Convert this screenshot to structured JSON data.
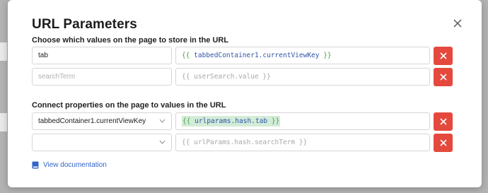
{
  "modal": {
    "title": "URL Parameters",
    "close_icon": "close-icon"
  },
  "store_section": {
    "label": "Choose which values on the page to store in the URL",
    "rows": [
      {
        "key": "tab",
        "key_placeholder": "",
        "value": "{{ tabbedContainer1.currentViewKey }}"
      },
      {
        "key": "",
        "key_placeholder": "searchTerm",
        "value_placeholder": "{{ userSearch.value }}"
      }
    ]
  },
  "connect_section": {
    "label": "Connect properties on the page to values in the URL",
    "rows": [
      {
        "property": "tabbedContainer1.currentViewKey",
        "value": "{{ urlparams.hash.tab }}"
      },
      {
        "property": "",
        "value_placeholder": "{{ urlParams.hash.searchTerm }}"
      }
    ]
  },
  "footer": {
    "doc_link_label": "View documentation",
    "doc_link_icon": "book-icon"
  },
  "colors": {
    "accent_red": "#e5493e",
    "link_blue": "#3264c8",
    "code_green": "#4aa146",
    "code_blue": "#2d55a8",
    "highlight_green": "#d3ecd8"
  }
}
